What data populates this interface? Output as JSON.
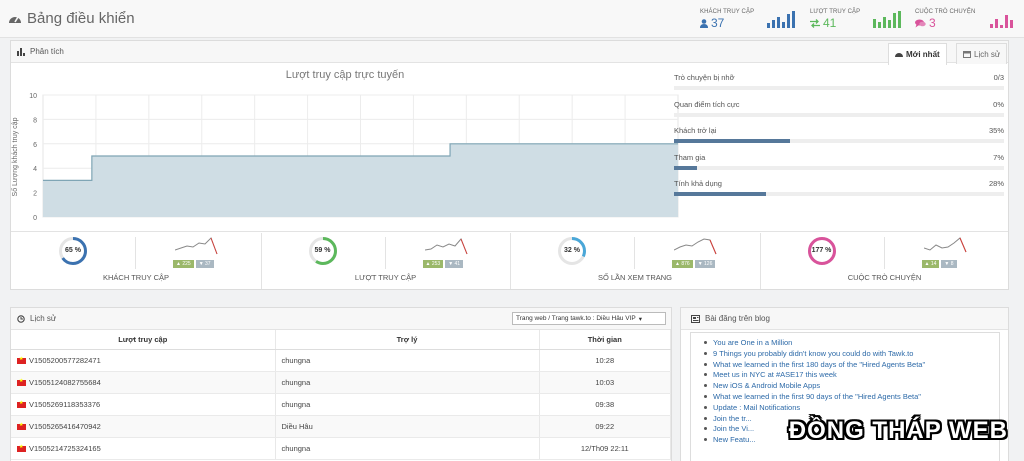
{
  "header": {
    "title": "Bảng điều khiển",
    "stats": [
      {
        "label": "KHÁCH TRUY CẬP",
        "value": "37",
        "icon": "user-icon",
        "color": "#3b72b0"
      },
      {
        "label": "LƯỢT TRUY CẬP",
        "value": "41",
        "icon": "exchange-icon",
        "color": "#5cb85c"
      },
      {
        "label": "CUỘC TRÒ CHUYỆN",
        "value": "3",
        "icon": "comments-icon",
        "color": "#d9539b"
      }
    ]
  },
  "analysis": {
    "title": "Phân tích",
    "tabs": [
      {
        "label": "Mới nhất",
        "icon": "dashboard-icon",
        "active": true
      },
      {
        "label": "Lịch sử",
        "icon": "calendar-icon",
        "active": false
      }
    ],
    "chart_title": "Lượt truy cập trực tuyến",
    "ylabel": "Số Lượng khách truy cập",
    "y_ticks": [
      "10",
      "8",
      "6",
      "4",
      "2",
      "0"
    ],
    "progress": [
      {
        "label": "Trò chuyện bị nhỡ",
        "value": "0/3",
        "fraction": 0
      },
      {
        "label": "Quan điểm tích cực",
        "value": "0%",
        "fraction": 0
      },
      {
        "label": "Khách trở lại",
        "value": "35%",
        "fraction": 0.35
      },
      {
        "label": "Tham gia",
        "value": "7%",
        "fraction": 0.07
      },
      {
        "label": "Tính khả dụng",
        "value": "28%",
        "fraction": 0.28
      }
    ],
    "kpis": [
      {
        "label": "KHÁCH TRUY CẬP",
        "percent": "65 %",
        "fraction": 0.65,
        "color": "#3b72b0",
        "badges": [
          "▲ 225",
          "▼ 37"
        ]
      },
      {
        "label": "LƯỢT TRUY CẬP",
        "percent": "59 %",
        "fraction": 0.59,
        "color": "#5cb85c",
        "badges": [
          "▲ 253",
          "▼ 41"
        ]
      },
      {
        "label": "SỐ LẦN XEM TRANG",
        "percent": "32 %",
        "fraction": 0.32,
        "color": "#4aa7d8",
        "badges": [
          "▲ 876",
          "▼ 126"
        ]
      },
      {
        "label": "CUỘC TRÒ CHUYỆN",
        "percent": "177 %",
        "fraction": 1,
        "color": "#d9539b",
        "badges": [
          "▲ 14",
          "▼ 8"
        ]
      }
    ]
  },
  "chart_data": {
    "type": "area",
    "title": "Lượt truy cập trực tuyến",
    "ylabel": "Số Lượng khách truy cập",
    "xlabel": "",
    "ylim": [
      0,
      10
    ],
    "grid": true,
    "values": [
      3,
      3,
      3,
      5,
      5,
      5,
      5,
      5,
      5,
      5,
      5,
      5,
      5,
      5,
      5,
      5,
      5,
      5,
      5,
      5,
      5,
      5,
      5,
      5,
      5,
      6,
      6,
      6,
      6,
      6,
      6,
      6,
      6,
      6,
      6,
      6,
      6,
      6,
      6,
      6
    ]
  },
  "history": {
    "title": "Lịch sử",
    "filter": "Trang web / Trang tawk.to : Diều Hâu VIP",
    "columns": [
      "Lượt truy cập",
      "Trợ lý",
      "Thời gian"
    ],
    "rows": [
      {
        "visitor": "V1505200577282471",
        "agent": "chungna",
        "time": "10:28"
      },
      {
        "visitor": "V1505124082755684",
        "agent": "chungna",
        "time": "10:03"
      },
      {
        "visitor": "V1505269118353376",
        "agent": "chungna",
        "time": "09:38"
      },
      {
        "visitor": "V1505265416470942",
        "agent": "Diều Hâu",
        "time": "09:22"
      },
      {
        "visitor": "V1505214725324165",
        "agent": "chungna",
        "time": "12/Th09 22:11"
      }
    ]
  },
  "blog": {
    "title": "Bài đăng trên blog",
    "posts": [
      "You are One in a Million",
      "9 Things you probably didn't know you could do with Tawk.to",
      "What we learned in the first 180 days of the \"Hired Agents Beta\"",
      "Meet us in NYC at #ASE17 this week",
      "New iOS & Android Mobile Apps",
      "What we learned in the first 90 days of the \"Hired Agents Beta\"",
      "Update : Mail Notifications",
      "Join the tr...",
      "Join the Vi...",
      "New Featu..."
    ]
  },
  "watermark": "ĐỒNG THÁP WEB"
}
